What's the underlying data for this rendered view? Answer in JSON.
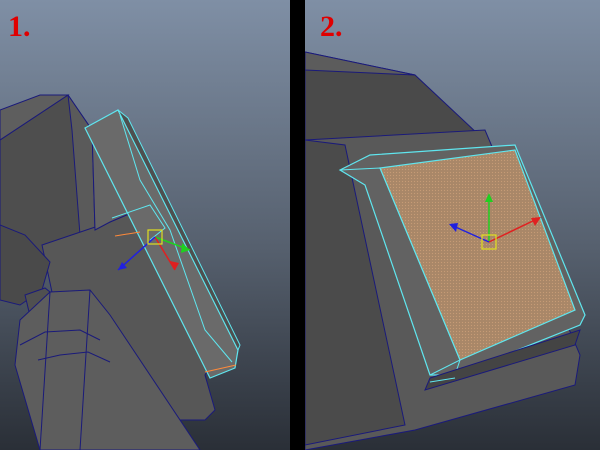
{
  "panels": [
    {
      "id": "panel-1",
      "label": "1."
    },
    {
      "id": "panel-2",
      "label": "2."
    }
  ],
  "colors": {
    "background_top": "#7f8fa5",
    "background_bottom": "#2a2f37",
    "mesh_face": "#5a5a5a",
    "edge_selected": "#5fe6ef",
    "edge_wire": "#1a1a7a",
    "face_selected": "#b08a6a",
    "manipulator_center": "#e0e020",
    "axis_x": "#e02020",
    "axis_y": "#20d020",
    "axis_z": "#2020e0",
    "label": "#e00000"
  }
}
